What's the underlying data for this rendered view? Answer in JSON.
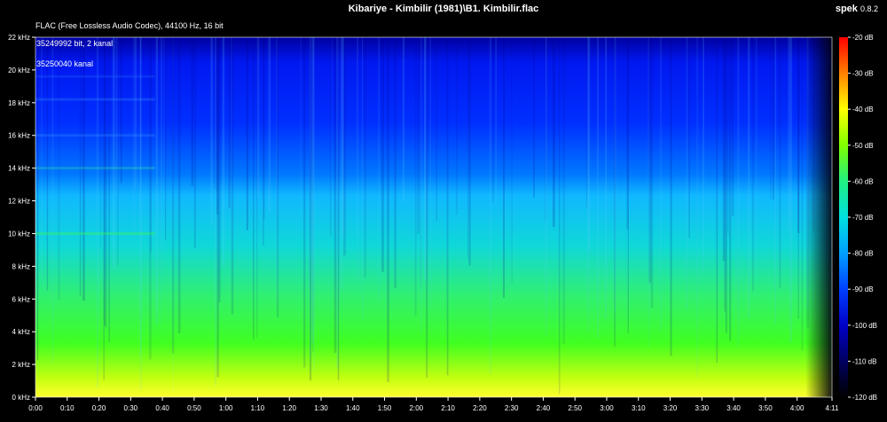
{
  "window": {
    "title": "Kibariye - Kimbilir (1981)\\B1. Kimbilir.flac",
    "app_name": "spek",
    "app_version": "0.8.2"
  },
  "file_info": "FLAC (Free Lossless Audio Codec), 44100 Hz, 16 bit",
  "overlay_texts": [
    "35249992 bit, 2 kanal",
    "35250040 kanal"
  ],
  "colors": {
    "background": "#000000",
    "text": "#ffffff",
    "palette": [
      "#000000",
      "#000040",
      "#0000a0",
      "#0018ff",
      "#0090ff",
      "#00e0e0",
      "#20f0a0",
      "#40ff20",
      "#c0ff00",
      "#ffff00",
      "#ff8000",
      "#ff0000"
    ]
  },
  "chart_data": {
    "type": "heatmap",
    "subtype": "spectrogram",
    "x_tick_labels": [
      "0:00",
      "0:10",
      "0:20",
      "0:30",
      "0:40",
      "0:50",
      "1:00",
      "1:10",
      "1:20",
      "1:30",
      "1:40",
      "1:50",
      "2:00",
      "2:10",
      "2:20",
      "2:30",
      "2:40",
      "2:50",
      "3:00",
      "3:10",
      "3:20",
      "3:30",
      "3:40",
      "3:50",
      "4:00",
      "4:11"
    ],
    "x_ticks_seconds": [
      0,
      10,
      20,
      30,
      40,
      50,
      60,
      70,
      80,
      90,
      100,
      110,
      120,
      130,
      140,
      150,
      160,
      170,
      180,
      190,
      200,
      210,
      220,
      230,
      240,
      251
    ],
    "xlim_seconds": [
      0,
      251
    ],
    "y_tick_labels": [
      "0 kHz",
      "2 kHz",
      "4 kHz",
      "6 kHz",
      "8 kHz",
      "10 kHz",
      "12 kHz",
      "14 kHz",
      "16 kHz",
      "18 kHz",
      "20 kHz",
      "22 kHz"
    ],
    "y_ticks_khz": [
      0,
      2,
      4,
      6,
      8,
      10,
      12,
      14,
      16,
      18,
      20,
      22
    ],
    "ylim_khz": [
      0,
      22
    ],
    "colorbar_labels": [
      "-20 dB",
      "-30 dB",
      "-40 dB",
      "-50 dB",
      "-60 dB",
      "-70 dB",
      "-80 dB",
      "-90 dB",
      "-100 dB",
      "-110 dB",
      "-120 dB"
    ],
    "colorbar_db": [
      -20,
      -30,
      -40,
      -50,
      -60,
      -70,
      -80,
      -90,
      -100,
      -110,
      -120
    ],
    "colorbar_range_db": [
      -120,
      -20
    ]
  }
}
